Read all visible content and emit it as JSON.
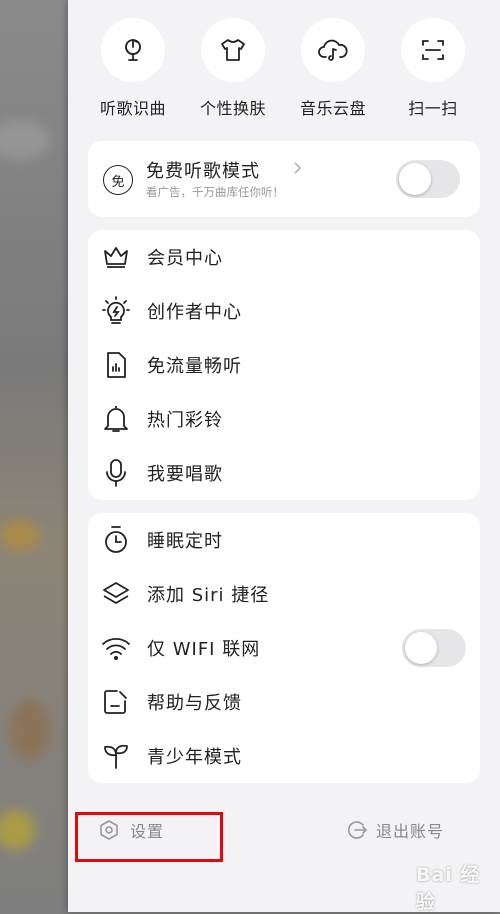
{
  "quick_actions": [
    {
      "label": "听歌识曲",
      "icon": "music-recognition-icon"
    },
    {
      "label": "个性换肤",
      "icon": "tshirt-icon"
    },
    {
      "label": "音乐云盘",
      "icon": "cloud-music-icon"
    },
    {
      "label": "扫一扫",
      "icon": "scan-icon"
    }
  ],
  "free_mode": {
    "title": "免费听歌模式",
    "subtitle": "看广告，千万曲库任你听！",
    "icon_text": "免",
    "toggle_on": false
  },
  "menu_group_1": [
    {
      "label": "会员中心",
      "icon": "crown-icon"
    },
    {
      "label": "创作者中心",
      "icon": "lightbulb-icon"
    },
    {
      "label": "免流量畅听",
      "icon": "sim-card-icon"
    },
    {
      "label": "热门彩铃",
      "icon": "bell-icon"
    },
    {
      "label": "我要唱歌",
      "icon": "microphone-icon"
    }
  ],
  "menu_group_2": [
    {
      "label": "睡眠定时",
      "icon": "timer-icon"
    },
    {
      "label": "添加 Siri 捷径",
      "icon": "layers-icon"
    },
    {
      "label": "仅 WIFI 联网",
      "icon": "wifi-icon",
      "toggle_on": false
    },
    {
      "label": "帮助与反馈",
      "icon": "feedback-icon"
    },
    {
      "label": "青少年模式",
      "icon": "sprout-icon"
    }
  ],
  "footer": {
    "settings_label": "设置",
    "logout_label": "退出账号"
  },
  "watermark": "Bai 经验",
  "colors": {
    "drawer_bg": "#f3f3f5",
    "card_bg": "#ffffff",
    "highlight": "#e10a0a",
    "text": "#222222",
    "muted": "#888888"
  }
}
